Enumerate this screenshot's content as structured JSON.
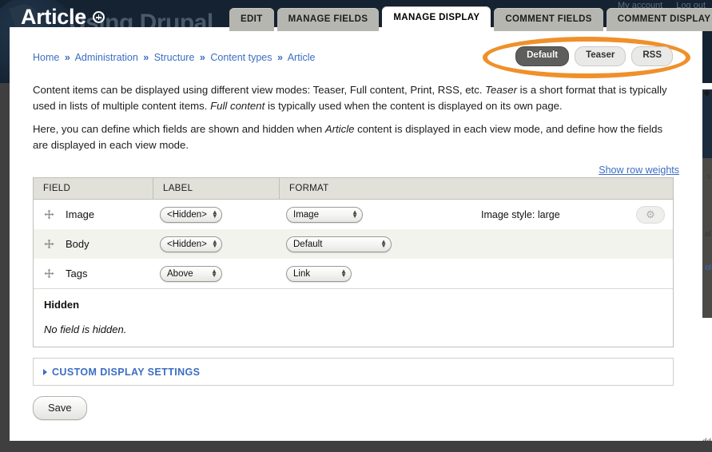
{
  "background": {
    "site_name": "Using Drupal",
    "user_links": [
      "My account",
      "Log out"
    ],
    "right_rail_snippets": [
      "s",
      "al",
      "ol",
      "Add"
    ]
  },
  "overlay_title": {
    "text": "Article",
    "add_icon": "add-circle-icon"
  },
  "tabs": [
    {
      "label": "EDIT",
      "active": false
    },
    {
      "label": "MANAGE FIELDS",
      "active": false
    },
    {
      "label": "MANAGE DISPLAY",
      "active": true
    },
    {
      "label": "COMMENT FIELDS",
      "active": false
    },
    {
      "label": "COMMENT DISPLAY",
      "active": false
    }
  ],
  "breadcrumb": {
    "separator": "»",
    "items": [
      "Home",
      "Administration",
      "Structure",
      "Content types",
      "Article"
    ]
  },
  "view_modes": {
    "highlight_color": "#f0902a",
    "buttons": [
      {
        "label": "Default",
        "active": true
      },
      {
        "label": "Teaser",
        "active": false
      },
      {
        "label": "RSS",
        "active": false
      }
    ]
  },
  "description": {
    "paragraph_1_a": "Content items can be displayed using different view modes: Teaser, Full content, Print, RSS, etc. ",
    "paragraph_1_em1": "Teaser",
    "paragraph_1_b": " is a short format that is typically used in lists of multiple content items. ",
    "paragraph_1_em2": "Full content",
    "paragraph_1_c": " is typically used when the content is displayed on its own page.",
    "paragraph_2_a": "Here, you can define which fields are shown and hidden when ",
    "paragraph_2_em1": "Article",
    "paragraph_2_b": " content is displayed in each view mode, and define how the fields are displayed in each view mode."
  },
  "row_weights_link": "Show row weights",
  "field_table": {
    "columns": [
      "FIELD",
      "LABEL",
      "FORMAT"
    ],
    "rows": [
      {
        "drag_icon": "drag-move-icon",
        "field": "Image",
        "label_value": "<Hidden>",
        "format_value": "Image",
        "format_note": "Image style: large",
        "has_settings": true,
        "settings_icon": "gear-icon",
        "striped": false
      },
      {
        "drag_icon": "drag-move-icon",
        "field": "Body",
        "label_value": "<Hidden>",
        "format_value": "Default",
        "format_note": "",
        "has_settings": false,
        "striped": true
      },
      {
        "drag_icon": "drag-move-icon",
        "field": "Tags",
        "label_value": "Above",
        "format_value": "Link",
        "format_note": "",
        "has_settings": false,
        "striped": false
      }
    ],
    "hidden_section": {
      "title": "Hidden",
      "empty_text": "No field is hidden."
    }
  },
  "custom_display_settings": {
    "label": "CUSTOM DISPLAY SETTINGS",
    "arrow_icon": "triangle-right-icon",
    "expanded": false
  },
  "save_button": "Save"
}
